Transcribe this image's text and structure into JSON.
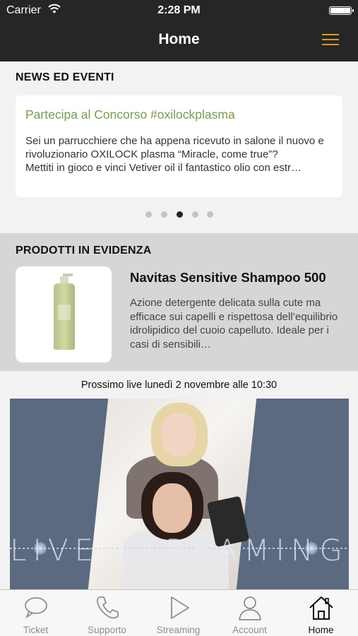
{
  "status_bar": {
    "carrier": "Carrier",
    "time": "2:28 PM"
  },
  "nav": {
    "title": "Home",
    "menu_icon": "hamburger-menu-icon",
    "accent": "#d49a2a"
  },
  "news": {
    "section_title": "NEWS ED EVENTI",
    "card": {
      "headline": "Partecipa al Concorso #oxilockplasma",
      "body": "Sei un parrucchiere che ha appena ricevuto in salone il nuovo e rivoluzionario OXILOCK plasma “Miracle, come true”?\nMettiti in gioco e vinci Vetiver oil il fantastico olio con estr…"
    },
    "pager": {
      "count": 5,
      "active_index": 2
    }
  },
  "products": {
    "section_title": "PRODOTTI IN EVIDENZA",
    "item": {
      "name": "Navitas Sensitive Shampoo 500",
      "description": "Azione detergente delicata sulla cute ma efficace sui capelli e rispettosa dell’equilibrio idrolipidico del cuoio capelluto. Ideale per i casi di sensibili…"
    }
  },
  "live": {
    "label": "Prossimo live lunedì 2 novembre alle 10:30",
    "banner_text": "LIVE STREAMING"
  },
  "tabbar": {
    "tabs": [
      {
        "label": "Ticket",
        "icon": "speech-bubble-icon"
      },
      {
        "label": "Supporto",
        "icon": "phone-icon"
      },
      {
        "label": "Streaming",
        "icon": "play-icon"
      },
      {
        "label": "Account",
        "icon": "person-icon"
      },
      {
        "label": "Home",
        "icon": "house-icon",
        "active": true
      }
    ]
  }
}
